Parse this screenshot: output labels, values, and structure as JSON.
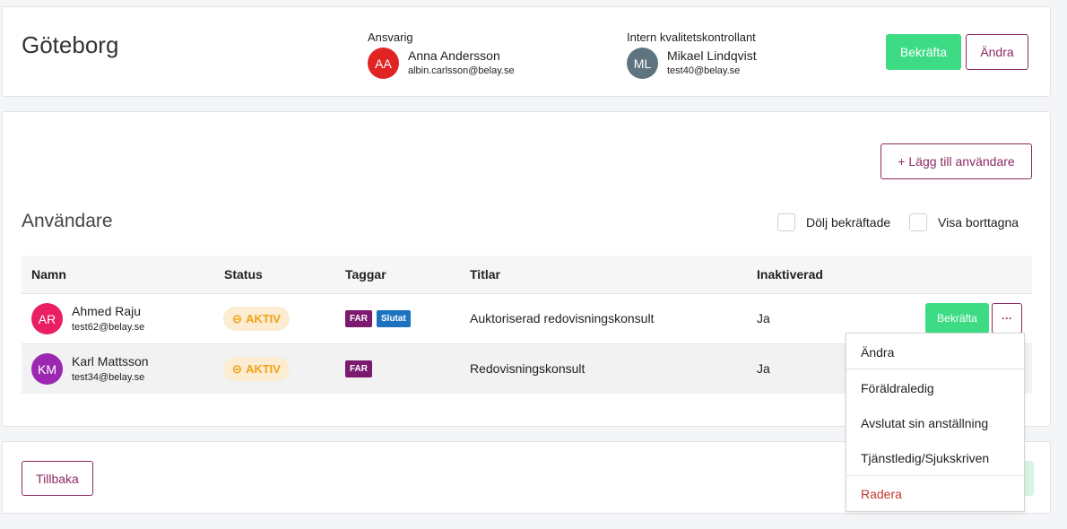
{
  "header": {
    "title": "Göteborg",
    "responsible": {
      "label": "Ansvarig",
      "initials": "AA",
      "name": "Anna Andersson",
      "email": "albin.carlsson@belay.se",
      "color": "#e02424"
    },
    "controller": {
      "label": "Intern kvalitetskontrollant",
      "initials": "ML",
      "name": "Mikael Lindqvist",
      "email": "test40@belay.se",
      "color": "#5f7481"
    },
    "confirm_label": "Bekräfta",
    "edit_label": "Ändra"
  },
  "users": {
    "add_user_label": "+ Lägg till användare",
    "section_title": "Användare",
    "hide_confirmed_label": "Dölj bekräftade",
    "show_deleted_label": "Visa borttagna",
    "columns": {
      "name": "Namn",
      "status": "Status",
      "tags": "Taggar",
      "titles": "Titlar",
      "inactivated": "Inaktiverad"
    },
    "rows": [
      {
        "initials": "AR",
        "avatar_color": "#e91e63",
        "name": "Ahmed Raju",
        "email": "test62@belay.se",
        "status": "AKTIV",
        "tags": [
          "FAR",
          "Slutat"
        ],
        "title": "Auktoriserad redovisningskonsult",
        "inactivated": "Ja",
        "confirm_label": "Bekräfta",
        "more_label": "···"
      },
      {
        "initials": "KM",
        "avatar_color": "#9c27b0",
        "name": "Karl Mattsson",
        "email": "test34@belay.se",
        "status": "AKTIV",
        "tags": [
          "FAR"
        ],
        "title": "Redovisningskonsult",
        "inactivated": "Ja"
      }
    ]
  },
  "context_menu": {
    "items": [
      "Ändra",
      "Föräldraledig",
      "Avslutat sin anställning",
      "Tjänstledig/Sjukskriven",
      "Radera"
    ]
  },
  "footer": {
    "back_label": "Tillbaka"
  },
  "colors": {
    "accent": "#8d2a62",
    "confirm_green": "#3ddc84",
    "status_text": "#f0a318",
    "status_bg": "#fcecd2",
    "danger": "#c0392b"
  }
}
